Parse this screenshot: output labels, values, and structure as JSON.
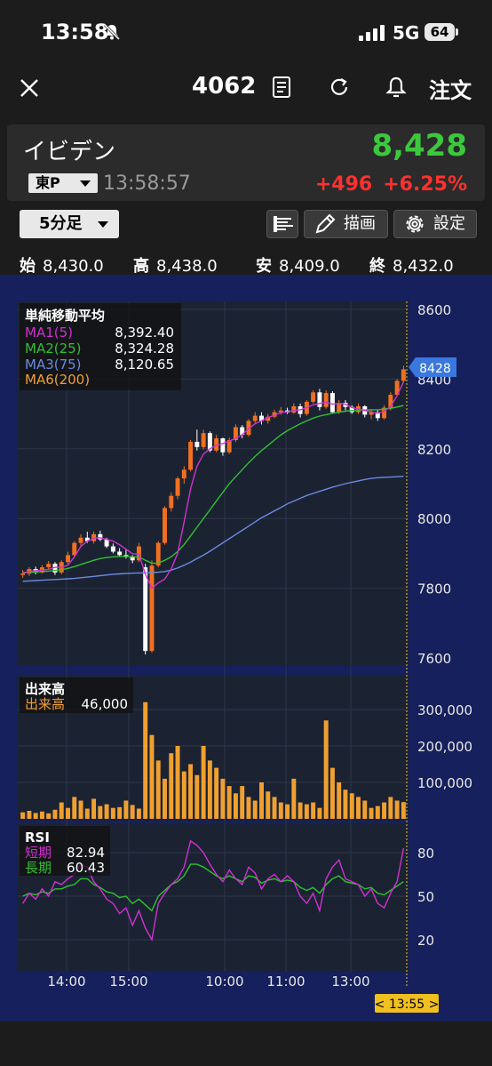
{
  "status_bar": {
    "time": "13:58",
    "network": "5G",
    "battery": "64"
  },
  "nav": {
    "code": "4062",
    "order_label": "注文"
  },
  "stock": {
    "name": "イビデン",
    "market": "東P",
    "timestamp": "13:58:57",
    "price": "8,428",
    "change": "+496",
    "change_pct": "+6.25%",
    "colors": {
      "up": "#3cc83c",
      "down": "#ff3030"
    }
  },
  "toolbar": {
    "timeframe": "5分足",
    "draw_label": "描画",
    "settings_label": "設定"
  },
  "ohlc": {
    "open_label": "始",
    "open": "8,430.0",
    "high_label": "高",
    "high": "8,438.0",
    "low_label": "安",
    "low": "8,409.0",
    "close_label": "終",
    "close": "8,432.0"
  },
  "price_panel": {
    "title": "単純移動平均",
    "legend": [
      {
        "name": "MA1(5)",
        "value": "8,392.40",
        "color": "#d030d0"
      },
      {
        "name": "MA2(25)",
        "value": "8,324.28",
        "color": "#30c030"
      },
      {
        "name": "MA3(75)",
        "value": "8,120.65",
        "color": "#6a8ae0"
      },
      {
        "name": "MA6(200)",
        "value": "",
        "color": "#f0a030"
      }
    ],
    "y_ticks": [
      "8600",
      "8400",
      "8200",
      "8000",
      "7800",
      "7600"
    ],
    "price_tag": "8428"
  },
  "volume_panel": {
    "title": "出来高",
    "legend_name": "出来高",
    "legend_value": "46,000",
    "y_ticks": [
      "300,000",
      "200,000",
      "100,000"
    ]
  },
  "rsi_panel": {
    "title": "RSI",
    "short_label": "短期",
    "short_value": "82.94",
    "long_label": "長期",
    "long_value": "60.43",
    "y_ticks": [
      "80",
      "50",
      "20"
    ]
  },
  "x_axis": {
    "ticks": [
      "14:00",
      "15:00",
      "10:00",
      "11:00",
      "13:00"
    ],
    "cursor_label": "< 13:55 >"
  },
  "chart_data": {
    "type": "candlestick",
    "interval": "5分足",
    "candles": [
      {
        "o": 7838,
        "h": 7852,
        "l": 7830,
        "c": 7842
      },
      {
        "o": 7842,
        "h": 7860,
        "l": 7835,
        "c": 7855
      },
      {
        "o": 7855,
        "h": 7862,
        "l": 7840,
        "c": 7845
      },
      {
        "o": 7845,
        "h": 7866,
        "l": 7842,
        "c": 7860
      },
      {
        "o": 7860,
        "h": 7878,
        "l": 7855,
        "c": 7870
      },
      {
        "o": 7870,
        "h": 7875,
        "l": 7838,
        "c": 7845
      },
      {
        "o": 7845,
        "h": 7880,
        "l": 7840,
        "c": 7875
      },
      {
        "o": 7875,
        "h": 7905,
        "l": 7870,
        "c": 7895
      },
      {
        "o": 7895,
        "h": 7935,
        "l": 7890,
        "c": 7930
      },
      {
        "o": 7930,
        "h": 7955,
        "l": 7920,
        "c": 7945
      },
      {
        "o": 7945,
        "h": 7962,
        "l": 7930,
        "c": 7935
      },
      {
        "o": 7935,
        "h": 7962,
        "l": 7928,
        "c": 7955
      },
      {
        "o": 7955,
        "h": 7965,
        "l": 7935,
        "c": 7940
      },
      {
        "o": 7940,
        "h": 7945,
        "l": 7915,
        "c": 7920
      },
      {
        "o": 7920,
        "h": 7928,
        "l": 7900,
        "c": 7905
      },
      {
        "o": 7905,
        "h": 7915,
        "l": 7890,
        "c": 7895
      },
      {
        "o": 7895,
        "h": 7910,
        "l": 7885,
        "c": 7890
      },
      {
        "o": 7890,
        "h": 7895,
        "l": 7872,
        "c": 7880
      },
      {
        "o": 7880,
        "h": 7930,
        "l": 7875,
        "c": 7920
      },
      {
        "o": 7860,
        "h": 7870,
        "l": 7610,
        "c": 7620
      },
      {
        "o": 7620,
        "h": 7880,
        "l": 7615,
        "c": 7865
      },
      {
        "o": 7865,
        "h": 7935,
        "l": 7860,
        "c": 7930
      },
      {
        "o": 7930,
        "h": 8035,
        "l": 7925,
        "c": 8030
      },
      {
        "o": 8030,
        "h": 8075,
        "l": 8020,
        "c": 8065
      },
      {
        "o": 8065,
        "h": 8120,
        "l": 8055,
        "c": 8115
      },
      {
        "o": 8115,
        "h": 8150,
        "l": 8100,
        "c": 8140
      },
      {
        "o": 8140,
        "h": 8225,
        "l": 8135,
        "c": 8220
      },
      {
        "o": 8220,
        "h": 8255,
        "l": 8195,
        "c": 8205
      },
      {
        "o": 8205,
        "h": 8255,
        "l": 8198,
        "c": 8245
      },
      {
        "o": 8245,
        "h": 8250,
        "l": 8190,
        "c": 8195
      },
      {
        "o": 8195,
        "h": 8240,
        "l": 8190,
        "c": 8230
      },
      {
        "o": 8230,
        "h": 8232,
        "l": 8180,
        "c": 8190
      },
      {
        "o": 8190,
        "h": 8232,
        "l": 8185,
        "c": 8225
      },
      {
        "o": 8225,
        "h": 8270,
        "l": 8220,
        "c": 8262
      },
      {
        "o": 8262,
        "h": 8268,
        "l": 8230,
        "c": 8240
      },
      {
        "o": 8240,
        "h": 8285,
        "l": 8235,
        "c": 8280
      },
      {
        "o": 8280,
        "h": 8305,
        "l": 8272,
        "c": 8295
      },
      {
        "o": 8295,
        "h": 8305,
        "l": 8270,
        "c": 8280
      },
      {
        "o": 8280,
        "h": 8300,
        "l": 8272,
        "c": 8292
      },
      {
        "o": 8292,
        "h": 8312,
        "l": 8288,
        "c": 8305
      },
      {
        "o": 8305,
        "h": 8320,
        "l": 8298,
        "c": 8310
      },
      {
        "o": 8310,
        "h": 8318,
        "l": 8300,
        "c": 8304
      },
      {
        "o": 8304,
        "h": 8330,
        "l": 8300,
        "c": 8322
      },
      {
        "o": 8322,
        "h": 8330,
        "l": 8290,
        "c": 8300
      },
      {
        "o": 8300,
        "h": 8340,
        "l": 8295,
        "c": 8335
      },
      {
        "o": 8335,
        "h": 8368,
        "l": 8330,
        "c": 8362
      },
      {
        "o": 8362,
        "h": 8372,
        "l": 8310,
        "c": 8320
      },
      {
        "o": 8320,
        "h": 8368,
        "l": 8315,
        "c": 8360
      },
      {
        "o": 8360,
        "h": 8365,
        "l": 8300,
        "c": 8305
      },
      {
        "o": 8305,
        "h": 8340,
        "l": 8300,
        "c": 8332
      },
      {
        "o": 8332,
        "h": 8340,
        "l": 8310,
        "c": 8320
      },
      {
        "o": 8320,
        "h": 8325,
        "l": 8300,
        "c": 8305
      },
      {
        "o": 8305,
        "h": 8330,
        "l": 8300,
        "c": 8322
      },
      {
        "o": 8322,
        "h": 8325,
        "l": 8290,
        "c": 8298
      },
      {
        "o": 8298,
        "h": 8312,
        "l": 8285,
        "c": 8305
      },
      {
        "o": 8305,
        "h": 8312,
        "l": 8280,
        "c": 8288
      },
      {
        "o": 8288,
        "h": 8325,
        "l": 8284,
        "c": 8318
      },
      {
        "o": 8318,
        "h": 8362,
        "l": 8310,
        "c": 8355
      },
      {
        "o": 8355,
        "h": 8400,
        "l": 8350,
        "c": 8395
      },
      {
        "o": 8395,
        "h": 8438,
        "l": 8390,
        "c": 8428
      }
    ],
    "ma1": [
      7842,
      7848,
      7850,
      7852,
      7854,
      7860,
      7860,
      7866,
      7890,
      7920,
      7935,
      7944,
      7945,
      7940,
      7935,
      7925,
      7912,
      7899,
      7898,
      7840,
      7800,
      7815,
      7826,
      7855,
      7900,
      7990,
      8085,
      8150,
      8185,
      8200,
      8210,
      8215,
      8222,
      8230,
      8240,
      8258,
      8272,
      8280,
      8290,
      8296,
      8304,
      8306,
      8310,
      8312,
      8318,
      8326,
      8330,
      8334,
      8328,
      8330,
      8328,
      8318,
      8314,
      8310,
      8306,
      8302,
      8308,
      8322,
      8352,
      8392
    ],
    "ma2": [
      7845,
      7846,
      7846,
      7848,
      7849,
      7851,
      7853,
      7857,
      7862,
      7868,
      7874,
      7880,
      7885,
      7888,
      7890,
      7891,
      7891,
      7890,
      7890,
      7880,
      7872,
      7872,
      7880,
      7890,
      7905,
      7925,
      7950,
      7975,
      8000,
      8025,
      8050,
      8075,
      8100,
      8120,
      8140,
      8160,
      8178,
      8195,
      8210,
      8225,
      8240,
      8252,
      8262,
      8272,
      8280,
      8288,
      8294,
      8298,
      8302,
      8305,
      8308,
      8310,
      8311,
      8312,
      8312,
      8312,
      8314,
      8316,
      8320,
      8324
    ],
    "ma3": [
      7820,
      7821,
      7822,
      7823,
      7824,
      7825,
      7826,
      7827,
      7828,
      7830,
      7832,
      7834,
      7836,
      7838,
      7840,
      7841,
      7842,
      7843,
      7844,
      7844,
      7845,
      7846,
      7848,
      7852,
      7858,
      7866,
      7875,
      7885,
      7895,
      7906,
      7918,
      7930,
      7942,
      7954,
      7966,
      7978,
      7990,
      8002,
      8012,
      8022,
      8032,
      8042,
      8050,
      8058,
      8066,
      8072,
      8078,
      8084,
      8090,
      8095,
      8100,
      8104,
      8108,
      8112,
      8115,
      8117,
      8118,
      8119,
      8120,
      8121
    ],
    "volume": [
      18000,
      22000,
      16000,
      20000,
      15000,
      25000,
      45000,
      30000,
      60000,
      50000,
      28000,
      55000,
      35000,
      40000,
      30000,
      32000,
      50000,
      38000,
      28000,
      320000,
      230000,
      160000,
      110000,
      180000,
      200000,
      130000,
      150000,
      120000,
      200000,
      160000,
      140000,
      110000,
      90000,
      70000,
      90000,
      60000,
      50000,
      100000,
      75000,
      60000,
      45000,
      40000,
      110000,
      45000,
      40000,
      45000,
      30000,
      270000,
      140000,
      100000,
      80000,
      70000,
      60000,
      50000,
      30000,
      35000,
      45000,
      60000,
      50000,
      46000
    ],
    "rsi_short": [
      45,
      52,
      48,
      55,
      50,
      60,
      58,
      62,
      65,
      72,
      70,
      60,
      55,
      48,
      45,
      38,
      42,
      30,
      40,
      28,
      20,
      45,
      52,
      58,
      62,
      70,
      88,
      85,
      80,
      72,
      65,
      60,
      68,
      62,
      58,
      70,
      66,
      55,
      62,
      65,
      60,
      64,
      60,
      50,
      45,
      52,
      40,
      62,
      70,
      75,
      62,
      60,
      58,
      50,
      55,
      45,
      42,
      52,
      60,
      83
    ],
    "rsi_long": [
      50,
      52,
      51,
      53,
      52,
      55,
      55,
      57,
      58,
      62,
      62,
      58,
      56,
      53,
      52,
      49,
      50,
      45,
      48,
      44,
      40,
      50,
      54,
      58,
      60,
      64,
      72,
      72,
      70,
      67,
      64,
      62,
      64,
      62,
      60,
      64,
      63,
      59,
      61,
      62,
      60,
      61,
      60,
      56,
      54,
      56,
      52,
      58,
      62,
      64,
      60,
      59,
      58,
      55,
      56,
      52,
      51,
      54,
      57,
      60
    ]
  }
}
